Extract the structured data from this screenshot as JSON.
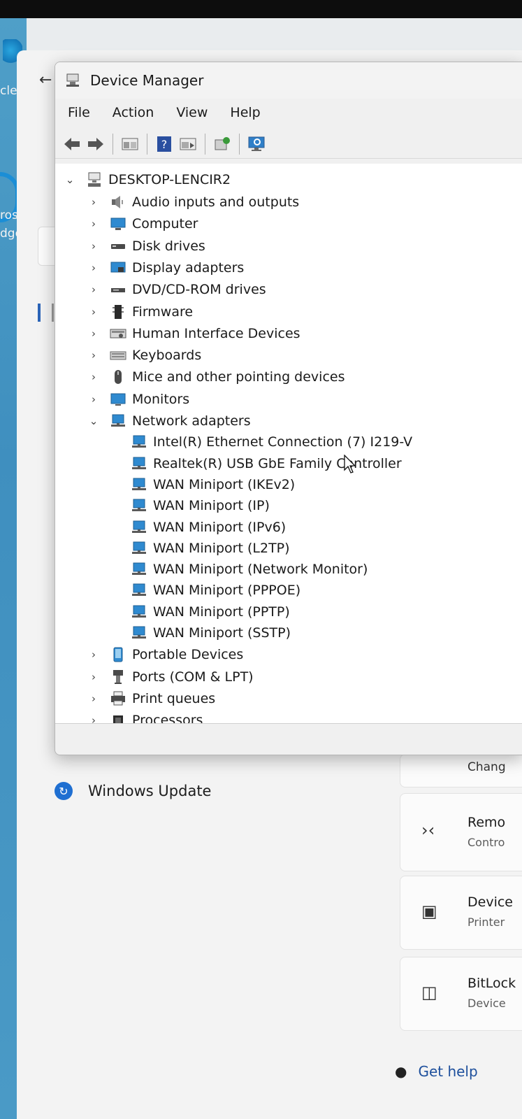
{
  "desktop": {
    "partial_labels": [
      "cle",
      "ros",
      "dge"
    ]
  },
  "settings": {
    "windows_update_label": "Windows Update",
    "cards": [
      {
        "title": "Remo",
        "subtitle": "Contro",
        "icon": "remote-desktop-icon"
      },
      {
        "title": "Device",
        "subtitle": "Printer",
        "icon": "device-encryption-icon"
      },
      {
        "title": "BitLock",
        "subtitle": "Device",
        "icon": "bitlocker-icon"
      }
    ],
    "partial_card_text": "Chang",
    "get_help_label": "Get help"
  },
  "device_manager": {
    "title": "Device Manager",
    "menu": [
      "File",
      "Action",
      "View",
      "Help"
    ],
    "toolbar": [
      "back-icon",
      "forward-icon",
      "properties-icon",
      "help-icon",
      "view-icon",
      "update-driver-icon",
      "scan-hardware-icon"
    ],
    "root": "DESKTOP-LENCIR2",
    "categories": [
      {
        "label": "Audio inputs and outputs",
        "icon": "audio-icon"
      },
      {
        "label": "Computer",
        "icon": "computer-icon"
      },
      {
        "label": "Disk drives",
        "icon": "disk-icon"
      },
      {
        "label": "Display adapters",
        "icon": "display-adapter-icon"
      },
      {
        "label": "DVD/CD-ROM drives",
        "icon": "dvd-icon"
      },
      {
        "label": "Firmware",
        "icon": "firmware-icon"
      },
      {
        "label": "Human Interface Devices",
        "icon": "hid-icon"
      },
      {
        "label": "Keyboards",
        "icon": "keyboard-icon"
      },
      {
        "label": "Mice and other pointing devices",
        "icon": "mouse-icon"
      },
      {
        "label": "Monitors",
        "icon": "monitor-icon"
      },
      {
        "label": "Network adapters",
        "icon": "network-icon",
        "expanded": true
      },
      {
        "label": "Portable Devices",
        "icon": "portable-device-icon"
      },
      {
        "label": "Ports (COM & LPT)",
        "icon": "port-icon"
      },
      {
        "label": "Print queues",
        "icon": "printer-icon"
      },
      {
        "label": "Processors",
        "icon": "processor-icon"
      }
    ],
    "network_adapters": [
      "Intel(R) Ethernet Connection (7) I219-V",
      "Realtek(R) USB GbE Family Controller",
      "WAN Miniport (IKEv2)",
      "WAN Miniport (IP)",
      "WAN Miniport (IPv6)",
      "WAN Miniport (L2TP)",
      "WAN Miniport (Network Monitor)",
      "WAN Miniport (PPPOE)",
      "WAN Miniport (PPTP)",
      "WAN Miniport (SSTP)"
    ]
  }
}
